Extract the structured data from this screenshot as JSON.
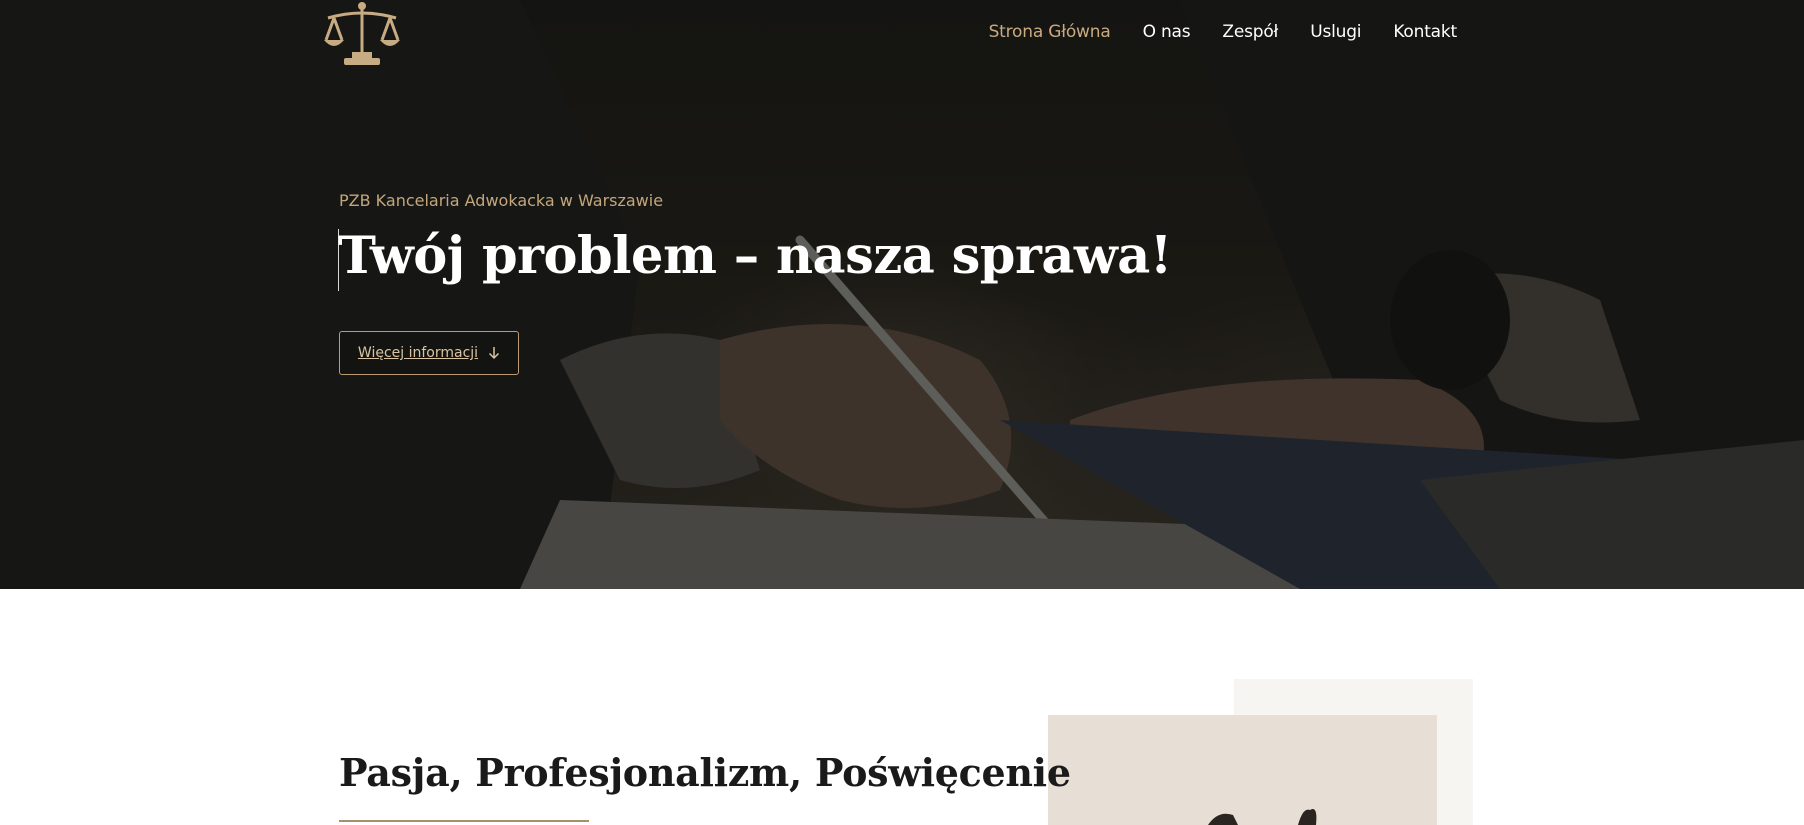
{
  "header": {
    "logo_icon": "scales-of-justice-icon",
    "nav": [
      {
        "label": "Strona Główna",
        "active": true
      },
      {
        "label": "O nas",
        "active": false
      },
      {
        "label": "Zespół",
        "active": false
      },
      {
        "label": "Uslugi",
        "active": false
      },
      {
        "label": "Kontakt",
        "active": false
      }
    ]
  },
  "hero": {
    "eyebrow": "PZB Kancelaria Adwokacka w Warszawie",
    "title": "Twój problem – nasza sprawa!",
    "button_label": "Więcej informacji",
    "button_icon": "arrow-down-icon"
  },
  "about": {
    "title": "Pasja, Profesjonalizm, Poświęcenie"
  },
  "colors": {
    "accent": "#c4a67c",
    "hero_overlay": "#1b1b18",
    "white": "#ffffff"
  }
}
